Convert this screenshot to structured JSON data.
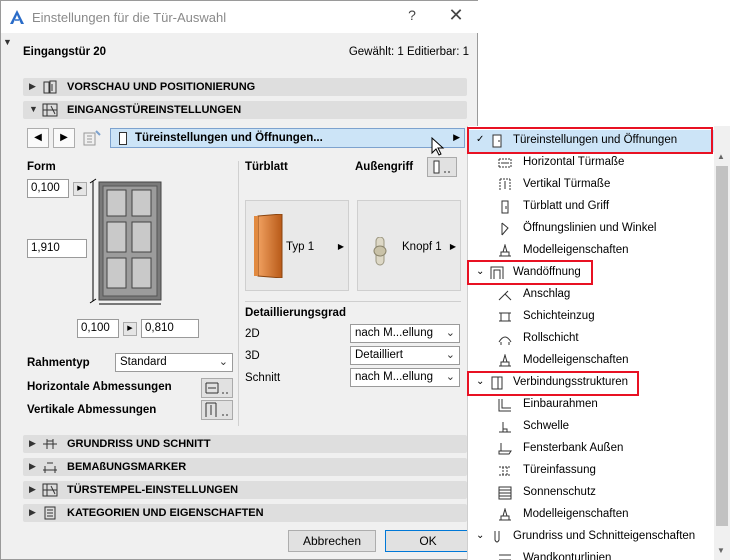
{
  "window": {
    "title": "Einstellungen für die Tür-Auswahl",
    "help_glyph": "?",
    "close_glyph": "✕"
  },
  "header": {
    "element_name": "Eingangstür 20",
    "selection_info": "Gewählt: 1 Editierbar: 1"
  },
  "sections_top": [
    {
      "label": "VORSCHAU UND POSITIONIERUNG",
      "icon": "preview-icon",
      "expanded": false
    },
    {
      "label": "EINGANGSTÜREINSTELLUNGEN",
      "icon": "door-settings-icon",
      "expanded": true
    }
  ],
  "page_selector": {
    "label": "Türeinstellungen und Öffnungen..."
  },
  "form": {
    "title": "Form",
    "top_value": "0,100",
    "height_value": "1,910",
    "bottom_left_value": "0,100",
    "width_value": "0,810",
    "frame_type_label": "Rahmentyp",
    "frame_type_value": "Standard",
    "horizontal_label": "Horizontale Abmessungen",
    "vertical_label": "Vertikale Abmessungen"
  },
  "leaf": {
    "title": "Türblatt",
    "type_label": "Typ 1"
  },
  "handle": {
    "title": "Außengriff",
    "type_label": "Knopf 1"
  },
  "detail": {
    "title": "Detaillierungsgrad",
    "rows": [
      {
        "label": "2D",
        "value": "nach M...ellung"
      },
      {
        "label": "3D",
        "value": "Detailliert"
      },
      {
        "label": "Schnitt",
        "value": "nach M...ellung"
      }
    ]
  },
  "sections_bottom": [
    {
      "label": "GRUNDRISS UND SCHNITT",
      "icon": "floorplan-icon"
    },
    {
      "label": "BEMAßUNGSMARKER",
      "icon": "dimension-marker-icon"
    },
    {
      "label": "TÜRSTEMPEL-EINSTELLUNGEN",
      "icon": "marker-stamp-icon"
    },
    {
      "label": "KATEGORIEN UND EIGENSCHAFTEN",
      "icon": "categories-icon"
    }
  ],
  "buttons": {
    "cancel": "Abbrechen",
    "ok": "OK"
  },
  "menu": {
    "groups": [
      {
        "label": "Türeinstellungen und Öffnungen",
        "icon": "door-page-icon",
        "items": [
          {
            "label": "Horizontal Türmaße",
            "icon": "horizontal-dim-icon"
          },
          {
            "label": "Vertikal Türmaße",
            "icon": "vertical-dim-icon"
          },
          {
            "label": "Türblatt und Griff",
            "icon": "leaf-handle-icon"
          },
          {
            "label": "Öffnungslinien und Winkel",
            "icon": "opening-lines-icon"
          },
          {
            "label": "Modelleigenschaften",
            "icon": "model-attributes-icon"
          }
        ]
      },
      {
        "label": "Wandöffnung",
        "icon": "wall-opening-icon",
        "items": [
          {
            "label": "Anschlag",
            "icon": "reveal-icon"
          },
          {
            "label": "Schichteinzug",
            "icon": "layer-inset-icon"
          },
          {
            "label": "Rollschicht",
            "icon": "soldier-course-icon"
          },
          {
            "label": "Modelleigenschaften",
            "icon": "model-attributes-icon"
          }
        ]
      },
      {
        "label": "Verbindungsstrukturen",
        "icon": "connection-structures-icon",
        "items": [
          {
            "label": "Einbaurahmen",
            "icon": "casing-frame-icon"
          },
          {
            "label": "Schwelle",
            "icon": "threshold-icon"
          },
          {
            "label": "Fensterbank Außen",
            "icon": "sill-icon"
          },
          {
            "label": "Türeinfassung",
            "icon": "door-trim-icon"
          },
          {
            "label": "Sonnenschutz",
            "icon": "sunshade-icon"
          },
          {
            "label": "Modelleigenschaften",
            "icon": "model-attributes-icon"
          }
        ]
      },
      {
        "label": "Grundriss und Schnitteigenschaften",
        "icon": "plan-section-icon",
        "items": [
          {
            "label": "Wandkonturlinien",
            "icon": "wall-contour-icon"
          }
        ]
      }
    ]
  }
}
